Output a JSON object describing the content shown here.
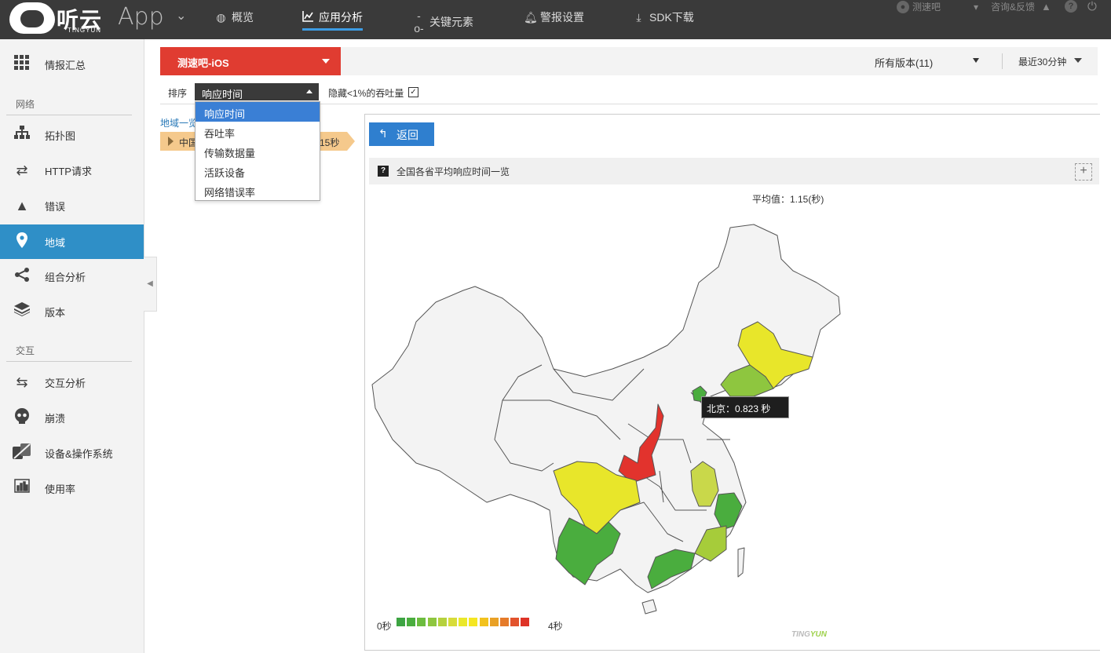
{
  "topbar": {
    "logo_text": "听云",
    "logo_sub": "TINGYUN",
    "app_label": "App",
    "nav": [
      {
        "label": "概览",
        "icon": "globe-icon"
      },
      {
        "label": "应用分析",
        "icon": "line-chart-icon"
      },
      {
        "label": "关键元素",
        "icon": "key-element-icon"
      },
      {
        "label": "警报设置",
        "icon": "bell-icon"
      },
      {
        "label": "SDK下载",
        "icon": "download-icon"
      }
    ],
    "user": "测速吧",
    "feedback": "咨询&反馈"
  },
  "sidebar": {
    "items": [
      {
        "label": "情报汇总",
        "icon": "grid-icon"
      },
      {
        "label": "拓扑图",
        "icon": "topology-icon"
      },
      {
        "label": "HTTP请求",
        "icon": "swap-arrows-icon"
      },
      {
        "label": "错误",
        "icon": "warning-icon"
      },
      {
        "label": "地域",
        "icon": "location-pin-icon"
      },
      {
        "label": "组合分析",
        "icon": "share-icon"
      },
      {
        "label": "版本",
        "icon": "layers-icon"
      },
      {
        "label": "交互分析",
        "icon": "interaction-icon"
      },
      {
        "label": "崩溃",
        "icon": "skull-icon"
      },
      {
        "label": "设备&操作系统",
        "icon": "device-os-icon"
      },
      {
        "label": "使用率",
        "icon": "bar-chart-icon"
      }
    ],
    "groups": {
      "network": "网络",
      "interaction": "交互"
    }
  },
  "appbar": {
    "app_name": "测速吧-iOS",
    "version": "所有版本(11)",
    "time_range": "最近30分钟"
  },
  "filter": {
    "sort_label": "排序",
    "sort_value": "响应时间",
    "sort_options": [
      "响应时间",
      "吞吐率",
      "传输数据量",
      "活跃设备",
      "网络错误率"
    ],
    "hide_label": "隐藏<1%的吞吐量",
    "hide_checked": "✓"
  },
  "breadcrumb": {
    "label": "地域一览"
  },
  "region_tag": {
    "name": "中国",
    "value": "15秒"
  },
  "panel": {
    "back_label": "返回",
    "chart_title": "全国各省平均响应时间一览",
    "average": "平均值：1.15(秒)"
  },
  "tooltip": {
    "text": "北京：0.823 秒"
  },
  "legend": {
    "low": "0秒",
    "high": "4秒",
    "colors": [
      "#3da442",
      "#4aad3e",
      "#6cbc3f",
      "#8ec63f",
      "#b5d13d",
      "#d7dc39",
      "#eae82a",
      "#f5e622",
      "#f2c21e",
      "#e9a126",
      "#e57b2a",
      "#e2532d",
      "#de3327"
    ]
  },
  "brand": {
    "prefix": "TING",
    "suffix": "YUN"
  },
  "colors": {
    "accent_red": "#e03c31",
    "accent_blue": "#2f7fcf",
    "sidebar_active": "#2f8fc7",
    "topbar": "#3a3a3a"
  }
}
